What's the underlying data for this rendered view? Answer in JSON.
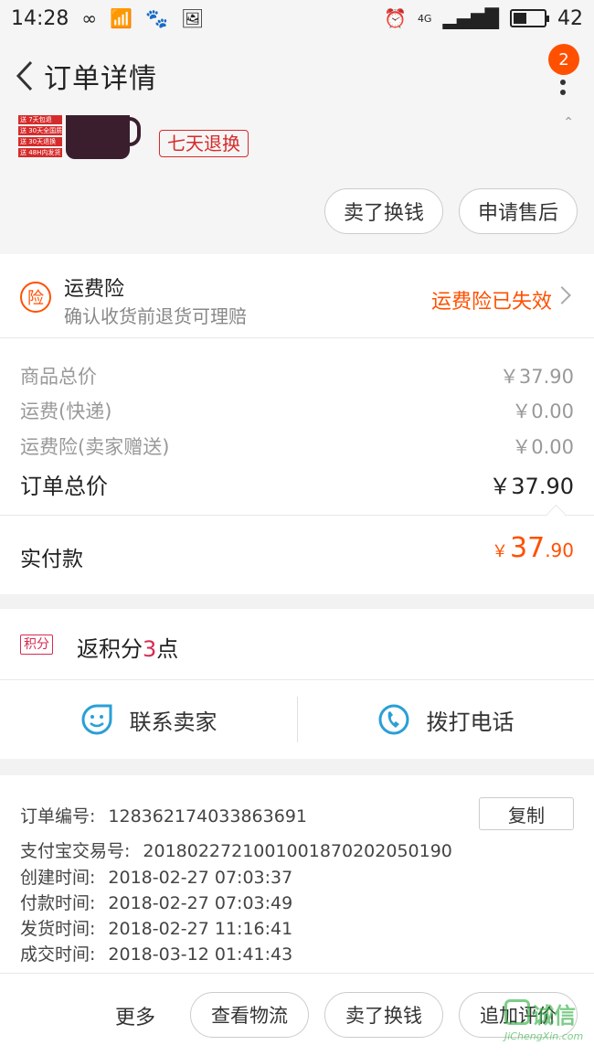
{
  "status_bar": {
    "time": "14:28",
    "network": "4G",
    "battery": "42"
  },
  "navbar": {
    "title": "订单详情",
    "badge_count": "2"
  },
  "product": {
    "promo_tags": [
      "送 7天包退",
      "送 30天全国质保",
      "送 30天退换",
      "送 48H内发货"
    ],
    "refund_tag": "七天退换",
    "sell_button": "卖了换钱",
    "aftersale_button": "申请售后"
  },
  "insurance": {
    "icon_char": "险",
    "title": "运费险",
    "subtitle": "确认收货前退货可理赔",
    "status": "运费险已失效"
  },
  "prices": {
    "rows": [
      {
        "label": "商品总价",
        "value": "￥37.90"
      },
      {
        "label": "运费(快递)",
        "value": "￥0.00"
      },
      {
        "label": "运费险(卖家赠送)",
        "value": "￥0.00"
      }
    ],
    "total_label": "订单总价",
    "total_value": "￥37.90",
    "paid_label": "实付款",
    "paid_currency": "￥",
    "paid_int": "37",
    "paid_dec": ".90"
  },
  "points": {
    "badge": "积分",
    "text_pre": "返积分",
    "num": "3",
    "text_post": "点"
  },
  "contact": {
    "seller_label": "联系卖家",
    "call_label": "拨打电话"
  },
  "order_info": {
    "order_no_label": "订单编号:",
    "order_no": "128362174033863691",
    "copy_label": "复制",
    "alipay_label": "支付宝交易号:",
    "alipay_no": "2018022721001001870202050190",
    "created_label": "创建时间:",
    "created": "2018-02-27 07:03:37",
    "paid_label": "付款时间:",
    "paid": "2018-02-27 07:03:49",
    "shipped_label": "发货时间:",
    "shipped": "2018-02-27 11:16:41",
    "completed_label": "成交时间:",
    "completed": "2018-03-12 01:41:43"
  },
  "bottom_bar": {
    "more": "更多",
    "logistics": "查看物流",
    "sell": "卖了换钱",
    "review": "追加评价"
  },
  "watermark": {
    "chars": "诚信",
    "latin": "JiChengXin.com"
  },
  "colors": {
    "accent": "#ff5000",
    "points": "#d62b52",
    "contact_icon": "#2a9fd6"
  }
}
